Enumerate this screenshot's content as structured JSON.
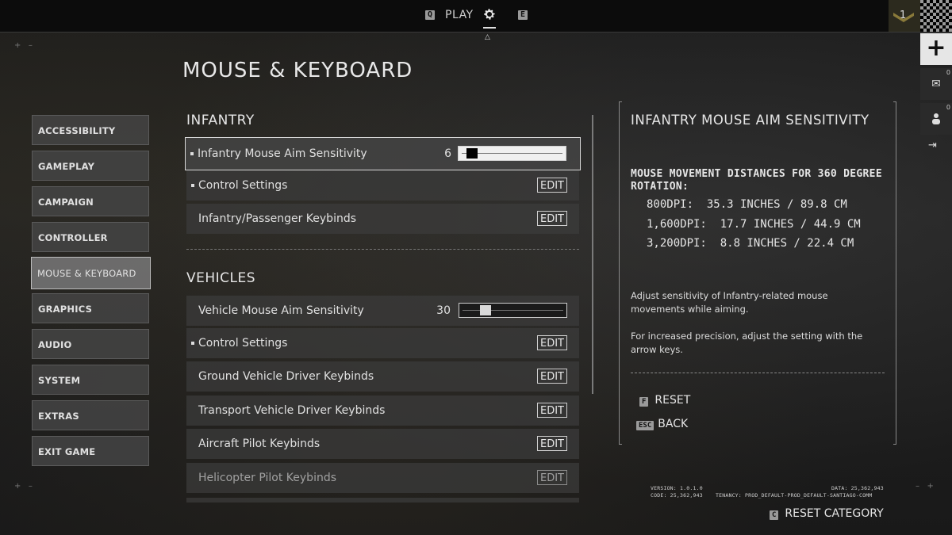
{
  "topbar": {
    "left_key": "Q",
    "play_label": "PLAY",
    "right_key": "E",
    "rank_number": "1"
  },
  "rail": {
    "mail_count": "0",
    "friends_count": "0"
  },
  "page_title": "MOUSE & KEYBOARD",
  "nav": {
    "items": [
      {
        "label": "ACCESSIBILITY",
        "active": false
      },
      {
        "label": "GAMEPLAY",
        "active": false
      },
      {
        "label": "CAMPAIGN",
        "active": false
      },
      {
        "label": "CONTROLLER",
        "active": false
      },
      {
        "label": "MOUSE & KEYBOARD",
        "active": true
      },
      {
        "label": "GRAPHICS",
        "active": false
      },
      {
        "label": "AUDIO",
        "active": false
      },
      {
        "label": "SYSTEM",
        "active": false
      },
      {
        "label": "EXTRAS",
        "active": false
      },
      {
        "label": "EXIT GAME",
        "active": false
      }
    ]
  },
  "infantry": {
    "heading": "INFANTRY",
    "aim_label": "Infantry Mouse Aim Sensitivity",
    "aim_value": "6",
    "aim_fraction": 0.06,
    "control_label": "Control Settings",
    "keybinds_label": "Infantry/Passenger Keybinds"
  },
  "vehicles": {
    "heading": "VEHICLES",
    "aim_label": "Vehicle Mouse Aim Sensitivity",
    "aim_value": "30",
    "aim_fraction": 0.2,
    "control_label": "Control Settings",
    "ground_label": "Ground Vehicle Driver Keybinds",
    "transport_label": "Transport Vehicle Driver Keybinds",
    "aircraft_label": "Aircraft Pilot Keybinds",
    "helicopter_label": "Helicopter Pilot Keybinds"
  },
  "edit_label": "EDIT",
  "panel": {
    "title": "INFANTRY MOUSE AIM SENSITIVITY",
    "subtitle": "MOUSE MOVEMENT DISTANCES FOR 360 DEGREE ROTATION:",
    "dpi_lines": [
      "800DPI:  35.3 INCHES / 89.8 CM",
      "1,600DPI:  17.7 INCHES / 44.9 CM",
      "3,200DPI:  8.8 INCHES / 22.4 CM"
    ],
    "desc1": "Adjust sensitivity of Infantry-related mouse movements while aiming.",
    "desc2": "For increased precision, adjust the setting with the arrow keys.",
    "reset_key": "F",
    "reset_label": "RESET",
    "back_key": "ESC",
    "back_label": "BACK"
  },
  "footer": {
    "version": "VERSION: 1.0.1.0",
    "code": "CODE: 25,362,943",
    "data": "DATA: 25,362,943",
    "tenancy": "TENANCY: PROD_DEFAULT-PROD_DEFAULT-SANTIAGO-COMM",
    "reset_cat_key": "C",
    "reset_cat_label": "RESET CATEGORY"
  }
}
